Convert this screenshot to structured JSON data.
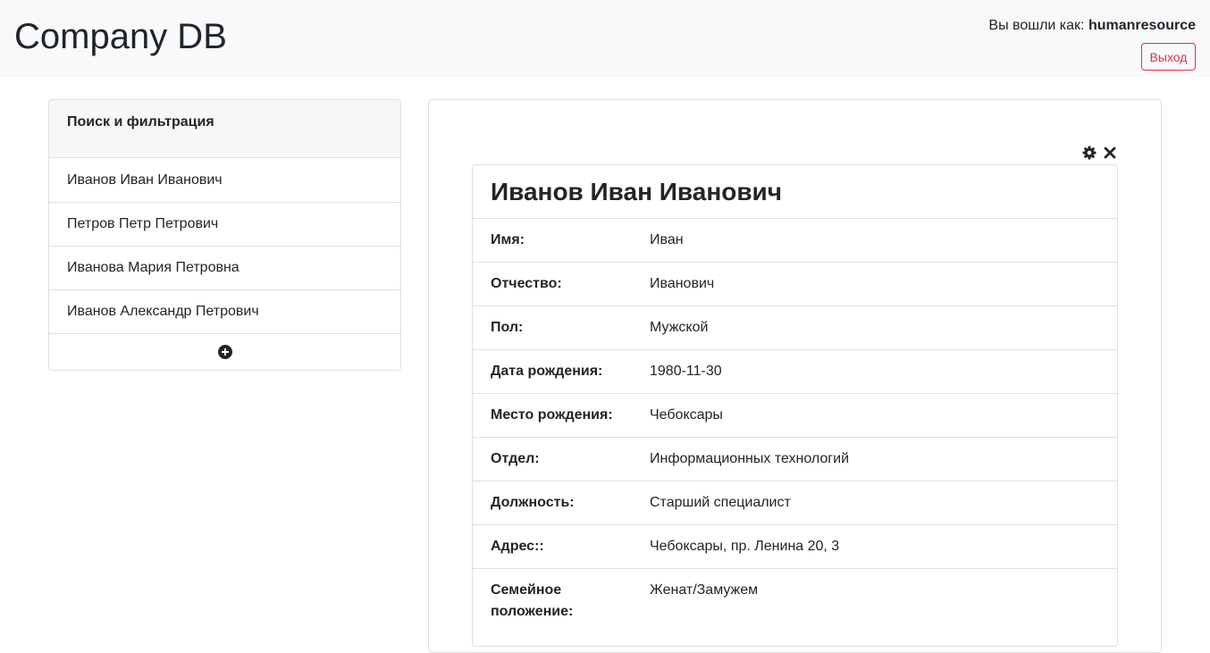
{
  "header": {
    "brand": "Company DB",
    "login_prefix": "Вы вошли как:",
    "username": "humanresource",
    "logout_label": "Выход"
  },
  "sidebar": {
    "filter_title": "Поиск и фильтрация",
    "employees": [
      "Иванов Иван Иванович",
      "Петров Петр Петрович",
      "Иванова Мария Петровна",
      "Иванов Александр Петрович"
    ],
    "add_icon": "plus-circle-icon"
  },
  "panel": {
    "settings_icon": "gear-icon",
    "close_icon": "close-icon"
  },
  "detail": {
    "title": "Иванов Иван Иванович",
    "fields": [
      {
        "label": "Имя:",
        "value": "Иван"
      },
      {
        "label": "Отчество:",
        "value": "Иванович"
      },
      {
        "label": "Пол:",
        "value": "Мужской"
      },
      {
        "label": "Дата рождения:",
        "value": "1980-11-30"
      },
      {
        "label": "Место рождения:",
        "value": "Чебоксары"
      },
      {
        "label": "Отдел:",
        "value": "Информационных технологий"
      },
      {
        "label": "Должность:",
        "value": "Старший специалист"
      },
      {
        "label": "Адрес::",
        "value": "Чебоксары, пр. Ленина 20, 3"
      },
      {
        "label": "Семейное положение:",
        "value": "Женат/Замужем"
      }
    ]
  },
  "colors": {
    "header_bg": "#f8f9fa",
    "danger": "#dc3545",
    "border": "#dfdfdf",
    "text": "#212529"
  }
}
